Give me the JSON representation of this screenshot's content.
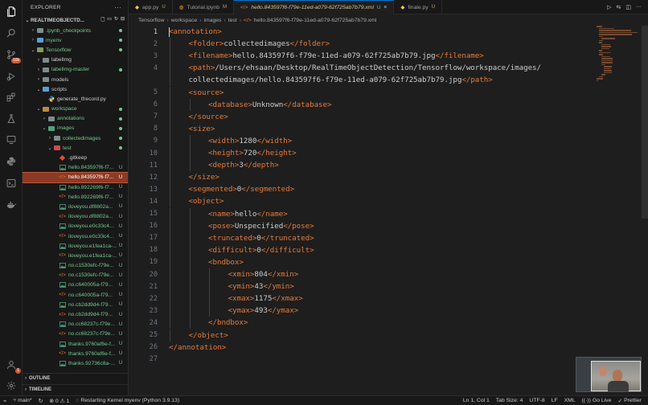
{
  "activity_bar": {
    "icons": [
      "files-icon",
      "search-icon",
      "source-control-icon",
      "run-debug-icon",
      "extensions-icon",
      "testing-icon",
      "remote-explorer-icon",
      "python-icon",
      "terminal-icon",
      "docker-icon"
    ],
    "source_control_badge": "10k",
    "accounts_badge": "1"
  },
  "sidebar": {
    "title": "EXPLORER",
    "more": "···",
    "root_label": "REALTIMEOBJECTD...",
    "items": [
      {
        "label": ".ipynb_checkpoints",
        "depth": 1,
        "kind": "folder",
        "chev": "›",
        "color": "#73c991",
        "folder_color": "#7f8c8d",
        "status": "dot"
      },
      {
        "label": "myenv",
        "depth": 1,
        "kind": "folder",
        "chev": "›",
        "color": "#73c991",
        "folder_color": "#5aa0d6",
        "status": "dot"
      },
      {
        "label": "Tensorflow",
        "depth": 1,
        "kind": "folder",
        "chev": "⌄",
        "color": "#73c991",
        "folder_color": "#8a9a5b",
        "status": "dot"
      },
      {
        "label": "labelImg",
        "depth": 2,
        "kind": "folder",
        "chev": "›",
        "color": "#cccccc",
        "folder_color": "#7f8c8d",
        "status": ""
      },
      {
        "label": "labelImg-master",
        "depth": 2,
        "kind": "folder",
        "chev": "›",
        "color": "#73c991",
        "folder_color": "#7f8c8d",
        "status": "dot"
      },
      {
        "label": "models",
        "depth": 2,
        "kind": "folder",
        "chev": "›",
        "color": "#cccccc",
        "folder_color": "#7f8c8d",
        "status": ""
      },
      {
        "label": "scripts",
        "depth": 2,
        "kind": "folder",
        "chev": "⌄",
        "color": "#cccccc",
        "folder_color": "#5aa0d6",
        "status": ""
      },
      {
        "label": "generate_tfrecord.py",
        "depth": 3,
        "kind": "py",
        "chev": "",
        "color": "#cccccc",
        "folder_color": "",
        "status": ""
      },
      {
        "label": "workspace",
        "depth": 2,
        "kind": "folder",
        "chev": "⌄",
        "color": "#73c991",
        "folder_color": "#c08a3e",
        "status": "dot"
      },
      {
        "label": "annotations",
        "depth": 3,
        "kind": "folder",
        "chev": "›",
        "color": "#73c991",
        "folder_color": "#7f8c8d",
        "status": "dot"
      },
      {
        "label": "images",
        "depth": 3,
        "kind": "folder",
        "chev": "⌄",
        "color": "#73c991",
        "folder_color": "#4ca37a",
        "status": "dot"
      },
      {
        "label": "collectedimages",
        "depth": 4,
        "kind": "folder",
        "chev": "›",
        "color": "#73c991",
        "folder_color": "#7f8c8d",
        "status": "dot"
      },
      {
        "label": "test",
        "depth": 4,
        "kind": "folder",
        "chev": "⌄",
        "color": "#73c991",
        "folder_color": "#d04a4a",
        "status": "dot"
      },
      {
        "label": ".gitkeep",
        "depth": 5,
        "kind": "gitkeep",
        "chev": "",
        "color": "#cccccc",
        "folder_color": "",
        "status": ""
      },
      {
        "label": "hello.843597f6-f7...",
        "depth": 5,
        "kind": "img",
        "chev": "",
        "color": "#73c991",
        "folder_color": "",
        "status": "U"
      },
      {
        "label": "hello.843597f6-f7...",
        "depth": 5,
        "kind": "xml",
        "chev": "",
        "color": "#e2c08d",
        "folder_color": "",
        "status": "U",
        "selected": true
      },
      {
        "label": "hello.892269f6-f7...",
        "depth": 5,
        "kind": "img",
        "chev": "",
        "color": "#73c991",
        "folder_color": "",
        "status": "U"
      },
      {
        "label": "hello.892269f6-f7...",
        "depth": 5,
        "kind": "xml",
        "chev": "",
        "color": "#73c991",
        "folder_color": "",
        "status": "U"
      },
      {
        "label": "iloveyou.df8802a...",
        "depth": 5,
        "kind": "img",
        "chev": "",
        "color": "#73c991",
        "folder_color": "",
        "status": "U"
      },
      {
        "label": "iloveyou.df8802a...",
        "depth": 5,
        "kind": "xml",
        "chev": "",
        "color": "#73c991",
        "folder_color": "",
        "status": "U"
      },
      {
        "label": "iloveyou.e0c33c4...",
        "depth": 5,
        "kind": "img",
        "chev": "",
        "color": "#73c991",
        "folder_color": "",
        "status": "U"
      },
      {
        "label": "iloveyou.e0c33c4...",
        "depth": 5,
        "kind": "xml",
        "chev": "",
        "color": "#73c991",
        "folder_color": "",
        "status": "U"
      },
      {
        "label": "iloveyou.e1fea1ca-...",
        "depth": 5,
        "kind": "img",
        "chev": "",
        "color": "#73c991",
        "folder_color": "",
        "status": "U"
      },
      {
        "label": "iloveyou.e1fea1ca-...",
        "depth": 5,
        "kind": "xml",
        "chev": "",
        "color": "#73c991",
        "folder_color": "",
        "status": "U"
      },
      {
        "label": "no.c1530efc-f79e...",
        "depth": 5,
        "kind": "img",
        "chev": "",
        "color": "#73c991",
        "folder_color": "",
        "status": "U"
      },
      {
        "label": "no.c1530efc-f79e...",
        "depth": 5,
        "kind": "xml",
        "chev": "",
        "color": "#73c991",
        "folder_color": "",
        "status": "U"
      },
      {
        "label": "no.c640005a-f79...",
        "depth": 5,
        "kind": "img",
        "chev": "",
        "color": "#73c991",
        "folder_color": "",
        "status": "U"
      },
      {
        "label": "no.c640005a-f79...",
        "depth": 5,
        "kind": "xml",
        "chev": "",
        "color": "#73c991",
        "folder_color": "",
        "status": "U"
      },
      {
        "label": "no.cb2dd9d4-f79...",
        "depth": 5,
        "kind": "img",
        "chev": "",
        "color": "#73c991",
        "folder_color": "",
        "status": "U"
      },
      {
        "label": "no.cb2dd9d4-f79...",
        "depth": 5,
        "kind": "xml",
        "chev": "",
        "color": "#73c991",
        "folder_color": "",
        "status": "U"
      },
      {
        "label": "no.cc68237c-f79e...",
        "depth": 5,
        "kind": "img",
        "chev": "",
        "color": "#73c991",
        "folder_color": "",
        "status": "U"
      },
      {
        "label": "no.cc68237c-f79e...",
        "depth": 5,
        "kind": "xml",
        "chev": "",
        "color": "#73c991",
        "folder_color": "",
        "status": "U"
      },
      {
        "label": "thanks.9760af6e-f...",
        "depth": 5,
        "kind": "img",
        "chev": "",
        "color": "#73c991",
        "folder_color": "",
        "status": "U"
      },
      {
        "label": "thanks.9760af6e-f...",
        "depth": 5,
        "kind": "xml",
        "chev": "",
        "color": "#73c991",
        "folder_color": "",
        "status": "U"
      },
      {
        "label": "thanks.92736c8a-...",
        "depth": 5,
        "kind": "img",
        "chev": "",
        "color": "#73c991",
        "folder_color": "",
        "status": "U"
      }
    ],
    "outline_label": "OUTLINE",
    "timeline_label": "TIMELINE"
  },
  "tabs": [
    {
      "label": "app.py",
      "status": "U",
      "icon": "python-file-icon",
      "active": false
    },
    {
      "label": "Tutorial.ipynb",
      "status": "M",
      "icon": "notebook-file-icon",
      "active": false
    },
    {
      "label": "hello.843597f6-f79e-11ed-a079-62f725ab7b79.xml",
      "status": "U",
      "icon": "xml-file-icon",
      "active": true
    },
    {
      "label": "finale.py",
      "status": "U",
      "icon": "python-file-icon",
      "active": false
    }
  ],
  "breadcrumb": [
    "Tensorflow",
    "workspace",
    "images",
    "test",
    "hello.843597f6-f79e-11ed-a079-62f725ab7b79.xml"
  ],
  "code": {
    "lines": [
      {
        "n": "1",
        "indent": 0,
        "t": [
          [
            "tag",
            "<annotation>"
          ]
        ]
      },
      {
        "n": "2",
        "indent": 1,
        "t": [
          [
            "tag",
            "<folder>"
          ],
          [
            "txt",
            "collectedimages"
          ],
          [
            "tag",
            "</folder>"
          ]
        ]
      },
      {
        "n": "3",
        "indent": 1,
        "t": [
          [
            "tag",
            "<filename>"
          ],
          [
            "txt",
            "hello.843597f6-f79e-11ed-a079-62f725ab7b79.jpg"
          ],
          [
            "tag",
            "</filename>"
          ]
        ]
      },
      {
        "n": "4",
        "indent": 1,
        "t": [
          [
            "tag",
            "<path>"
          ],
          [
            "txt",
            "/Users/ehsaan/Desktop/RealTimeObjectDetection/Tensorflow/workspace/images/"
          ]
        ]
      },
      {
        "n": "",
        "indent": 1,
        "t": [
          [
            "txt",
            "collectedimages/hello.843597f6-f79e-11ed-a079-62f725ab7b79.jpg"
          ],
          [
            "tag",
            "</path>"
          ]
        ]
      },
      {
        "n": "5",
        "indent": 1,
        "t": [
          [
            "tag",
            "<source>"
          ]
        ]
      },
      {
        "n": "6",
        "indent": 2,
        "t": [
          [
            "tag",
            "<database>"
          ],
          [
            "txt",
            "Unknown"
          ],
          [
            "tag",
            "</database>"
          ]
        ]
      },
      {
        "n": "7",
        "indent": 1,
        "t": [
          [
            "tag",
            "</source>"
          ]
        ]
      },
      {
        "n": "8",
        "indent": 1,
        "t": [
          [
            "tag",
            "<size>"
          ]
        ]
      },
      {
        "n": "9",
        "indent": 2,
        "t": [
          [
            "tag",
            "<width>"
          ],
          [
            "txt",
            "1280"
          ],
          [
            "tag",
            "</width>"
          ]
        ]
      },
      {
        "n": "10",
        "indent": 2,
        "t": [
          [
            "tag",
            "<height>"
          ],
          [
            "txt",
            "720"
          ],
          [
            "tag",
            "</height>"
          ]
        ]
      },
      {
        "n": "11",
        "indent": 2,
        "t": [
          [
            "tag",
            "<depth>"
          ],
          [
            "txt",
            "3"
          ],
          [
            "tag",
            "</depth>"
          ]
        ]
      },
      {
        "n": "12",
        "indent": 1,
        "t": [
          [
            "tag",
            "</size>"
          ]
        ]
      },
      {
        "n": "13",
        "indent": 1,
        "t": [
          [
            "tag",
            "<segmented>"
          ],
          [
            "txt",
            "0"
          ],
          [
            "tag",
            "</segmented>"
          ]
        ]
      },
      {
        "n": "14",
        "indent": 1,
        "t": [
          [
            "tag",
            "<object>"
          ]
        ]
      },
      {
        "n": "15",
        "indent": 2,
        "t": [
          [
            "tag",
            "<name>"
          ],
          [
            "txt",
            "hello"
          ],
          [
            "tag",
            "</name>"
          ]
        ]
      },
      {
        "n": "16",
        "indent": 2,
        "t": [
          [
            "tag",
            "<pose>"
          ],
          [
            "txt",
            "Unspecified"
          ],
          [
            "tag",
            "</pose>"
          ]
        ]
      },
      {
        "n": "17",
        "indent": 2,
        "t": [
          [
            "tag",
            "<truncated>"
          ],
          [
            "txt",
            "0"
          ],
          [
            "tag",
            "</truncated>"
          ]
        ]
      },
      {
        "n": "18",
        "indent": 2,
        "t": [
          [
            "tag",
            "<difficult>"
          ],
          [
            "txt",
            "0"
          ],
          [
            "tag",
            "</difficult>"
          ]
        ]
      },
      {
        "n": "19",
        "indent": 2,
        "t": [
          [
            "tag",
            "<bndbox>"
          ]
        ]
      },
      {
        "n": "20",
        "indent": 3,
        "t": [
          [
            "tag",
            "<xmin>"
          ],
          [
            "txt",
            "804"
          ],
          [
            "tag",
            "</xmin>"
          ]
        ]
      },
      {
        "n": "21",
        "indent": 3,
        "t": [
          [
            "tag",
            "<ymin>"
          ],
          [
            "txt",
            "43"
          ],
          [
            "tag",
            "</ymin>"
          ]
        ]
      },
      {
        "n": "22",
        "indent": 3,
        "t": [
          [
            "tag",
            "<xmax>"
          ],
          [
            "txt",
            "1175"
          ],
          [
            "tag",
            "</xmax>"
          ]
        ]
      },
      {
        "n": "23",
        "indent": 3,
        "t": [
          [
            "tag",
            "<ymax>"
          ],
          [
            "txt",
            "493"
          ],
          [
            "tag",
            "</ymax>"
          ]
        ]
      },
      {
        "n": "24",
        "indent": 2,
        "t": [
          [
            "tag",
            "</bndbox>"
          ]
        ]
      },
      {
        "n": "25",
        "indent": 1,
        "t": [
          [
            "tag",
            "</object>"
          ]
        ]
      },
      {
        "n": "26",
        "indent": 0,
        "t": [
          [
            "tag",
            "</annotation>"
          ]
        ]
      },
      {
        "n": "27",
        "indent": 0,
        "t": []
      }
    ],
    "current_line": "1"
  },
  "statusbar": {
    "branch": "main*",
    "problems": "⊗ 0 ⚠ 1",
    "kernel": "Restarting Kernel myenv (Python 3.9.13)",
    "position": "Ln 1, Col 1",
    "tab_size": "Tab Size: 4",
    "encoding": "UTF-8",
    "eol": "LF",
    "language": "XML",
    "go_live": "Go Live",
    "prettier": "Prettier"
  },
  "colors": {
    "accent": "#0078d4",
    "tag": "#e37b3a",
    "untracked": "#73c991",
    "modified": "#e2c08d"
  }
}
